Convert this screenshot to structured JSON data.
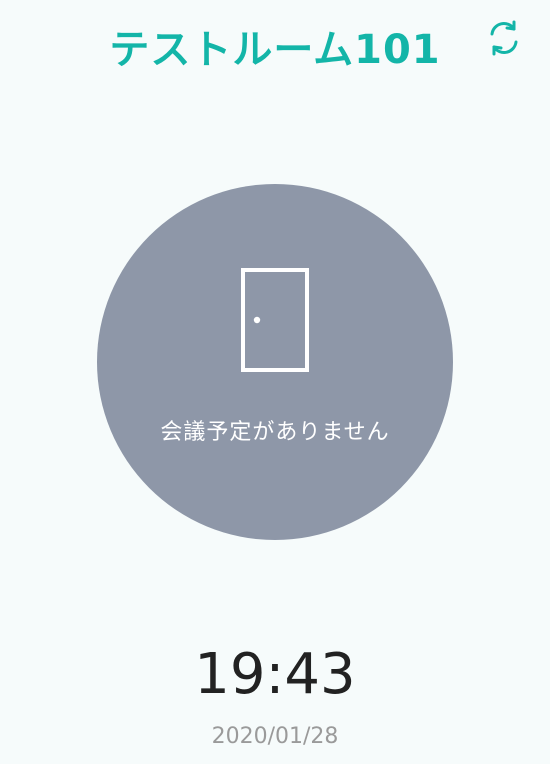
{
  "header": {
    "room_title": "テストルーム101",
    "refresh_icon": "refresh-icon"
  },
  "status": {
    "icon": "door-icon",
    "message": "会議予定がありません"
  },
  "clock": {
    "time": "19:43",
    "date": "2020/01/28"
  },
  "colors": {
    "accent": "#13b5a8",
    "background": "#f6fbfb",
    "status_circle": "#8e97a8",
    "time_text": "#222222",
    "date_text": "#9a9a9a"
  }
}
